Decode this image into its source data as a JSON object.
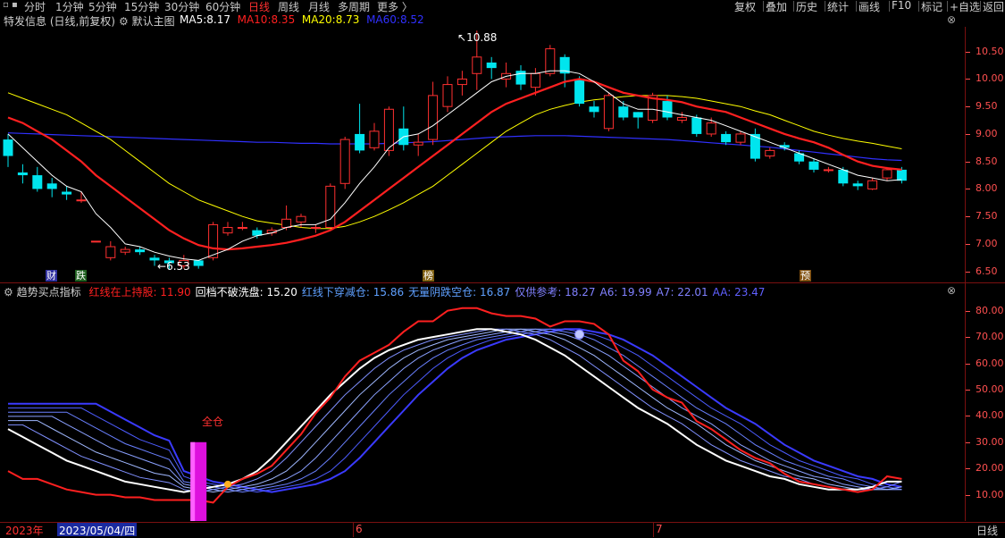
{
  "window_controls": "▫ ▪",
  "periods": [
    {
      "label": "分时",
      "active": false
    },
    {
      "label": "1分钟",
      "active": false
    },
    {
      "label": "5分钟",
      "active": false
    },
    {
      "label": "15分钟",
      "active": false
    },
    {
      "label": "30分钟",
      "active": false
    },
    {
      "label": "60分钟",
      "active": false
    },
    {
      "label": "日线",
      "active": true
    },
    {
      "label": "周线",
      "active": false
    },
    {
      "label": "月线",
      "active": false
    },
    {
      "label": "多周期",
      "active": false
    },
    {
      "label": "更多 〉",
      "active": false
    }
  ],
  "right_buttons": [
    "复权",
    "叠加",
    "历史",
    "统计",
    "画线",
    "F10",
    "标记",
    "+自选",
    "返回"
  ],
  "main_header": {
    "stock": "特发信息 (日线,前复权)",
    "template": "默认主图",
    "ma5_label": "MA5:",
    "ma5_value": "8.17",
    "ma10_label": "MA10:",
    "ma10_value": "8.35",
    "ma20_label": "MA20:",
    "ma20_value": "8.73",
    "ma60_label": "MA60:",
    "ma60_value": "8.52",
    "colors": {
      "ma5": "#ffffff",
      "ma10": "#ff2020",
      "ma20": "#ffff00",
      "ma60": "#3030ff"
    }
  },
  "indicator_header": {
    "name": "趋势买点指标",
    "items": [
      {
        "label": "红线在上持股:",
        "value": "11.90",
        "color": "#ff2020"
      },
      {
        "label": "回档不破洗盘:",
        "value": "15.20",
        "color": "#ffffff"
      },
      {
        "label": "红线下穿减仓:",
        "value": "15.86",
        "color": "#5fa0ff"
      },
      {
        "label": "无量阴跌空仓:",
        "value": "16.87",
        "color": "#5fa0ff"
      },
      {
        "label": "仅供参考:",
        "value": "18.27",
        "color": "#8080ff"
      },
      {
        "label": "A6:",
        "value": "19.99",
        "color": "#8080ff"
      },
      {
        "label": "A7:",
        "value": "22.01",
        "color": "#8080ff"
      },
      {
        "label": "AA:",
        "value": "23.47",
        "color": "#6060ff"
      }
    ]
  },
  "price_axis": [
    "10.50",
    "10.00",
    "9.50",
    "9.00",
    "8.50",
    "8.00",
    "7.50",
    "7.00",
    "6.50"
  ],
  "indicator_axis": [
    "80.00",
    "70.00",
    "60.00",
    "50.00",
    "40.00",
    "30.00",
    "20.00",
    "10.00"
  ],
  "price_annotations": {
    "high": "10.88",
    "low": "6.53"
  },
  "markers": [
    {
      "text": "财",
      "bg": "#3030a0",
      "color": "#ffffff"
    },
    {
      "text": "跌",
      "bg": "#206020",
      "color": "#ffffff"
    },
    {
      "text": "榜",
      "bg": "#806010",
      "color": "#ffffff"
    },
    {
      "text": "预",
      "bg": "#805010",
      "color": "#ffffff"
    }
  ],
  "signal_label": "全仓",
  "bottom": {
    "year": "2023年",
    "date": "2023/05/04/四",
    "month6": "6",
    "month7": "7",
    "period": "日线"
  },
  "chart_data": {
    "type": "candlestick",
    "ylim": [
      6.3,
      10.95
    ],
    "candles": [
      [
        8.9,
        8.6,
        9.0,
        8.4
      ],
      [
        8.3,
        8.25,
        8.45,
        8.1
      ],
      [
        8.25,
        8.0,
        8.4,
        7.95
      ],
      [
        8.1,
        8.0,
        8.2,
        7.85
      ],
      [
        7.95,
        7.9,
        8.05,
        7.8
      ],
      [
        7.8,
        7.8,
        7.95,
        7.75
      ],
      [
        7.05,
        7.05,
        7.05,
        7.05
      ],
      [
        6.75,
        6.95,
        7.05,
        6.7
      ],
      [
        6.85,
        6.9,
        6.95,
        6.8
      ],
      [
        6.9,
        6.85,
        6.95,
        6.8
      ],
      [
        6.75,
        6.7,
        6.8,
        6.6
      ],
      [
        6.7,
        6.65,
        6.75,
        6.53
      ],
      [
        6.6,
        6.7,
        6.8,
        6.55
      ],
      [
        6.7,
        6.6,
        6.7,
        6.55
      ],
      [
        6.75,
        7.35,
        7.4,
        6.7
      ],
      [
        7.2,
        7.3,
        7.4,
        7.15
      ],
      [
        7.3,
        7.3,
        7.4,
        7.25
      ],
      [
        7.25,
        7.15,
        7.3,
        7.1
      ],
      [
        7.2,
        7.25,
        7.3,
        7.15
      ],
      [
        7.3,
        7.45,
        7.7,
        7.25
      ],
      [
        7.4,
        7.5,
        7.55,
        7.3
      ],
      [
        7.3,
        7.3,
        7.35,
        7.2
      ],
      [
        7.3,
        8.05,
        8.1,
        7.3
      ],
      [
        8.1,
        8.9,
        8.95,
        8.0
      ],
      [
        9.0,
        8.7,
        9.55,
        8.65
      ],
      [
        8.75,
        9.05,
        9.2,
        8.7
      ],
      [
        8.7,
        9.45,
        9.5,
        8.6
      ],
      [
        9.1,
        8.8,
        9.5,
        8.7
      ],
      [
        8.8,
        8.85,
        9.0,
        8.6
      ],
      [
        8.9,
        9.7,
        9.95,
        8.8
      ],
      [
        9.5,
        9.9,
        10.05,
        9.4
      ],
      [
        9.9,
        10.0,
        10.15,
        9.7
      ],
      [
        10.1,
        10.4,
        10.88,
        9.8
      ],
      [
        10.3,
        10.2,
        10.4,
        10.0
      ],
      [
        10.0,
        10.1,
        10.3,
        9.85
      ],
      [
        10.15,
        9.9,
        10.25,
        9.8
      ],
      [
        9.85,
        10.1,
        10.2,
        9.7
      ],
      [
        10.1,
        10.55,
        10.62,
        10.05
      ],
      [
        10.4,
        10.1,
        10.45,
        9.85
      ],
      [
        10.0,
        9.55,
        10.05,
        9.5
      ],
      [
        9.5,
        9.4,
        9.6,
        9.3
      ],
      [
        9.1,
        9.7,
        9.75,
        9.05
      ],
      [
        9.5,
        9.3,
        9.6,
        9.25
      ],
      [
        9.4,
        9.3,
        9.4,
        9.1
      ],
      [
        9.25,
        9.7,
        9.75,
        9.2
      ],
      [
        9.6,
        9.3,
        9.7,
        9.25
      ],
      [
        9.25,
        9.3,
        9.4,
        9.2
      ],
      [
        9.3,
        9.0,
        9.35,
        8.95
      ],
      [
        9.0,
        9.2,
        9.3,
        8.95
      ],
      [
        9.0,
        8.85,
        9.05,
        8.8
      ],
      [
        8.85,
        9.0,
        9.05,
        8.8
      ],
      [
        9.0,
        8.55,
        9.1,
        8.5
      ],
      [
        8.6,
        8.7,
        8.75,
        8.55
      ],
      [
        8.8,
        8.75,
        8.85,
        8.7
      ],
      [
        8.65,
        8.5,
        8.7,
        8.45
      ],
      [
        8.5,
        8.35,
        8.55,
        8.3
      ],
      [
        8.35,
        8.35,
        8.4,
        8.3
      ],
      [
        8.35,
        8.1,
        8.4,
        8.05
      ],
      [
        8.1,
        8.05,
        8.15,
        7.98
      ],
      [
        8.0,
        8.15,
        8.2,
        7.98
      ],
      [
        8.2,
        8.35,
        8.4,
        8.15
      ],
      [
        8.35,
        8.15,
        8.4,
        8.1
      ]
    ],
    "ma5": [
      9.0,
      8.75,
      8.5,
      8.25,
      8.05,
      7.95,
      7.55,
      7.3,
      7.0,
      6.95,
      6.85,
      6.78,
      6.73,
      6.7,
      6.8,
      6.9,
      7.05,
      7.15,
      7.2,
      7.3,
      7.35,
      7.35,
      7.45,
      7.75,
      8.1,
      8.4,
      8.75,
      8.95,
      9.0,
      9.15,
      9.35,
      9.55,
      9.75,
      9.95,
      10.05,
      10.1,
      10.1,
      10.15,
      10.15,
      10.1,
      9.95,
      9.75,
      9.55,
      9.45,
      9.45,
      9.4,
      9.35,
      9.3,
      9.25,
      9.15,
      9.05,
      8.95,
      8.85,
      8.75,
      8.65,
      8.55,
      8.45,
      8.35,
      8.25,
      8.2,
      8.15,
      8.17
    ],
    "ma10": [
      9.3,
      9.2,
      9.05,
      8.9,
      8.7,
      8.5,
      8.25,
      8.05,
      7.85,
      7.65,
      7.45,
      7.25,
      7.1,
      6.98,
      6.92,
      6.9,
      6.92,
      6.95,
      6.98,
      7.02,
      7.08,
      7.15,
      7.25,
      7.4,
      7.6,
      7.8,
      8.0,
      8.2,
      8.4,
      8.6,
      8.8,
      9.0,
      9.2,
      9.4,
      9.55,
      9.65,
      9.75,
      9.85,
      9.95,
      10.0,
      9.95,
      9.85,
      9.75,
      9.7,
      9.65,
      9.62,
      9.58,
      9.5,
      9.45,
      9.4,
      9.3,
      9.2,
      9.1,
      9.0,
      8.92,
      8.85,
      8.75,
      8.62,
      8.5,
      8.42,
      8.38,
      8.35
    ],
    "ma20": [
      9.75,
      9.65,
      9.55,
      9.45,
      9.35,
      9.2,
      9.05,
      8.9,
      8.7,
      8.5,
      8.3,
      8.1,
      7.95,
      7.8,
      7.7,
      7.6,
      7.5,
      7.42,
      7.38,
      7.34,
      7.3,
      7.28,
      7.28,
      7.32,
      7.4,
      7.5,
      7.62,
      7.75,
      7.9,
      8.05,
      8.25,
      8.45,
      8.65,
      8.85,
      9.05,
      9.2,
      9.35,
      9.45,
      9.52,
      9.58,
      9.62,
      9.65,
      9.68,
      9.7,
      9.7,
      9.7,
      9.68,
      9.65,
      9.6,
      9.55,
      9.5,
      9.42,
      9.35,
      9.25,
      9.15,
      9.05,
      8.98,
      8.92,
      8.87,
      8.83,
      8.78,
      8.73
    ],
    "ma60": [
      9.02,
      9.01,
      9.0,
      8.99,
      8.98,
      8.97,
      8.96,
      8.95,
      8.94,
      8.93,
      8.92,
      8.91,
      8.9,
      8.89,
      8.88,
      8.87,
      8.86,
      8.85,
      8.85,
      8.84,
      8.83,
      8.83,
      8.82,
      8.82,
      8.82,
      8.82,
      8.83,
      8.84,
      8.85,
      8.86,
      8.88,
      8.9,
      8.92,
      8.94,
      8.95,
      8.96,
      8.97,
      8.97,
      8.97,
      8.96,
      8.95,
      8.94,
      8.93,
      8.92,
      8.91,
      8.9,
      8.88,
      8.86,
      8.84,
      8.82,
      8.8,
      8.78,
      8.76,
      8.73,
      8.7,
      8.67,
      8.64,
      8.61,
      8.58,
      8.55,
      8.53,
      8.52
    ],
    "indicator": {
      "ylim": [
        0,
        85
      ],
      "red": [
        19,
        16,
        16,
        14,
        12,
        11,
        10,
        10,
        9,
        9,
        8,
        8,
        8,
        8,
        7,
        13,
        16,
        18,
        21,
        27,
        33,
        41,
        47,
        55,
        61,
        64,
        67,
        72,
        76,
        76,
        80,
        81,
        81,
        79,
        78,
        78,
        77,
        74,
        76,
        76,
        75,
        71,
        61,
        57,
        50,
        47,
        45,
        38,
        35,
        31,
        27,
        24,
        22,
        18,
        15,
        14,
        13,
        12,
        11,
        12,
        17,
        16
      ],
      "white": [
        35,
        32,
        29,
        26,
        23,
        21,
        19,
        17,
        15,
        14,
        13,
        12,
        11,
        12,
        13,
        14,
        16,
        19,
        24,
        30,
        36,
        42,
        48,
        53,
        58,
        62,
        65,
        67,
        69,
        70,
        71,
        72,
        73,
        73,
        72,
        71,
        69,
        66,
        63,
        59,
        55,
        51,
        47,
        43,
        40,
        37,
        33,
        29,
        26,
        23,
        21,
        19,
        17,
        16,
        14,
        13,
        12,
        12,
        12,
        13,
        15,
        15
      ]
    }
  }
}
